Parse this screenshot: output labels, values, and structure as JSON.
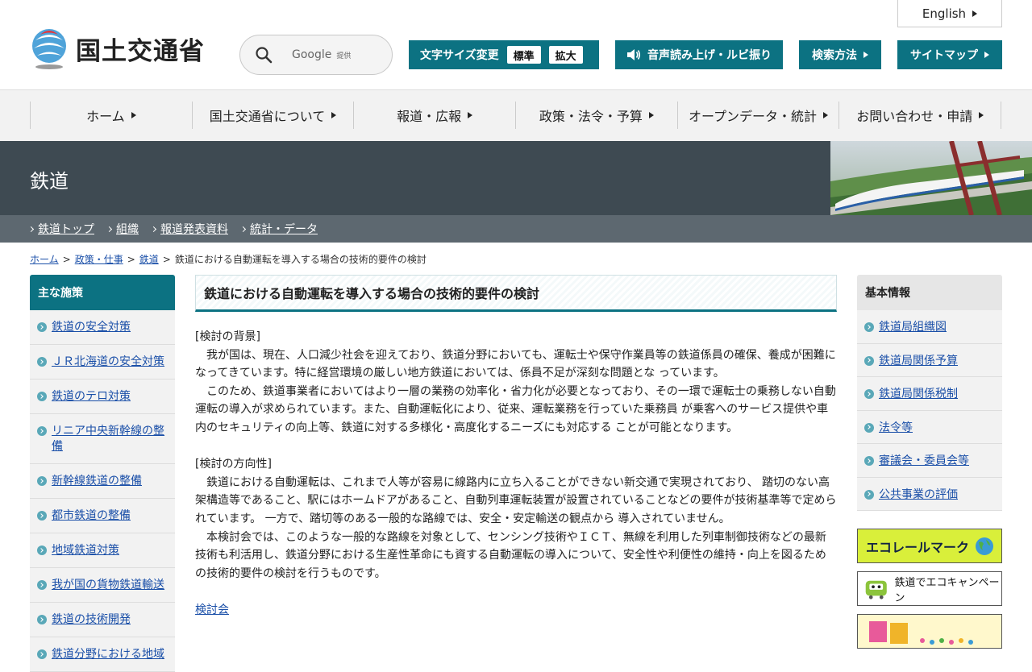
{
  "header": {
    "logo_text": "国土交通省",
    "search_brand": "Google",
    "search_brand_suffix": "提供",
    "english_label": "English",
    "font_size_label": "文字サイズ変更",
    "font_size_standard": "標準",
    "font_size_large": "拡大",
    "voice_label": "音声読み上げ・ルビ振り",
    "howto_label": "検索方法",
    "sitemap_label": "サイトマップ"
  },
  "gnav": {
    "items": [
      {
        "label": "ホーム"
      },
      {
        "label": "国土交通省について"
      },
      {
        "label": "報道・広報"
      },
      {
        "label": "政策・法令・予算"
      },
      {
        "label": "オープンデータ・統計"
      },
      {
        "label": "お問い合わせ・申請"
      }
    ]
  },
  "banner": {
    "title": "鉄道"
  },
  "subnav": {
    "items": [
      {
        "label": "鉄道トップ"
      },
      {
        "label": "組織"
      },
      {
        "label": "報道発表資料"
      },
      {
        "label": "統計・データ"
      }
    ]
  },
  "breadcrumb": {
    "home": "ホーム",
    "policy": "政策・仕事",
    "railway": "鉄道",
    "sep": ">",
    "current": "鉄道における自動運転を導入する場合の技術的要件の検討"
  },
  "left_sidebar": {
    "heading": "主な施策",
    "items": [
      {
        "label": "鉄道の安全対策"
      },
      {
        "label": "ＪＲ北海道の安全対策"
      },
      {
        "label": "鉄道のテロ対策"
      },
      {
        "label": "リニア中央新幹線の整備"
      },
      {
        "label": "新幹線鉄道の整備"
      },
      {
        "label": "都市鉄道の整備"
      },
      {
        "label": "地域鉄道対策"
      },
      {
        "label": "我が国の貨物鉄道輸送"
      },
      {
        "label": "鉄道の技術開発"
      },
      {
        "label": "鉄道分野における地域"
      }
    ]
  },
  "main": {
    "title": "鉄道における自動運転を導入する場合の技術的要件の検討",
    "section1_heading": "[検討の背景]",
    "section1_p1": "　我が国は、現在、人口減少社会を迎えており、鉄道分野においても、運転士や保守作業員等の鉄道係員の確保、養成が困難になってきています。特に経営環境の厳しい地方鉄道においては、係員不足が深刻な問題とな っています。",
    "section1_p2": "　このため、鉄道事業者においてはより一層の業務の効率化・省力化が必要となっており、その一環で運転士の乗務しない自動運転の導入が求められています。また、自動運転化により、従来、運転業務を行っていた乗務員 が乗客へのサービス提供や車内のセキュリティの向上等、鉄道に対する多様化・高度化するニーズにも対応する ことが可能となります。",
    "section2_heading": "[検討の方向性]",
    "section2_p1": "　鉄道における自動運転は、これまで人等が容易に線路内に立ち入ることができない新交通で実現されており、 踏切のない高架構造等であること、駅にはホームドアがあること、自動列車運転装置が設置されていることなどの要件が技術基準等で定められています。 一方で、踏切等のある一般的な路線では、安全・安定輸送の観点から 導入されていません。",
    "section2_p2": "　本検討会では、このような一般的な路線を対象として、センシング技術やＩＣＴ、無線を利用した列車制御技術などの最新技術も利活用し、鉄道分野における生産性革命にも資する自動運転の導入について、安全性や利便性の維持・向上を図るための技術的要件の検討を行うものです。",
    "link_label": "検討会"
  },
  "right_sidebar": {
    "heading": "基本情報",
    "items": [
      {
        "label": "鉄道局組織図"
      },
      {
        "label": "鉄道局関係予算"
      },
      {
        "label": "鉄道局関係税制"
      },
      {
        "label": "法令等"
      },
      {
        "label": "審議会・委員会等"
      },
      {
        "label": "公共事業の評価"
      }
    ],
    "banner_eco": "エコレールマーク",
    "banner_campaign": "鉄道でエコキャンペーン"
  },
  "colors": {
    "accent": "#0c7282",
    "banner_bg": "#3e4a52",
    "subnav_bg": "#5d6870",
    "link": "#1a4fa8"
  }
}
